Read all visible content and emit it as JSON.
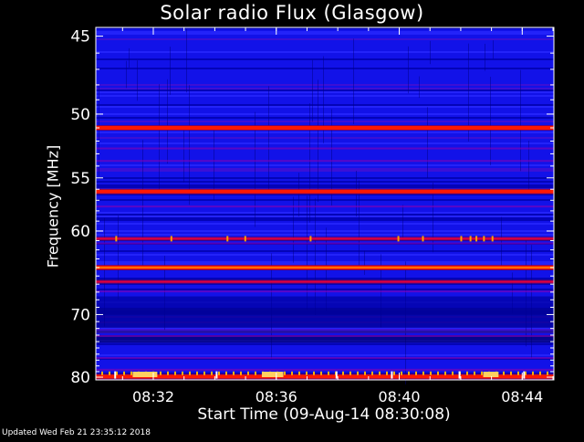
{
  "chart_data": {
    "type": "heatmap",
    "title": "Solar radio Flux (Glasgow)",
    "xlabel": "Start Time (09-Aug-14 08:30:08)",
    "ylabel": "Frequency [MHz]",
    "x_ticks": [
      "08:32",
      "08:36",
      "08:40",
      "08:44"
    ],
    "y_ticks": [
      45,
      50,
      55,
      60,
      70,
      80
    ],
    "y_tick_frequencies": [
      45,
      50,
      55,
      60,
      70,
      80
    ],
    "x_tick_minutes_after_start": [
      1.87,
      5.87,
      9.87,
      13.87
    ],
    "xlim_minutes": [
      0,
      14.9
    ],
    "ylim_mhz": [
      44.5,
      80.5
    ],
    "ylim_note": "frequency axis is reciprocal-scaled (1/f)",
    "bright_bands_mhz": [
      {
        "freq": 51.0,
        "intensity": "high"
      },
      {
        "freq": 56.2,
        "intensity": "high"
      },
      {
        "freq": 64.0,
        "intensity": "high"
      },
      {
        "freq": 65.7,
        "intensity": "medium"
      },
      {
        "freq": 60.8,
        "intensity": "medium"
      },
      {
        "freq": 79.9,
        "intensity": "high"
      }
    ],
    "colormap": [
      "#000040",
      "#1a1aff",
      "#7a00c0",
      "#ff0000",
      "#ffa000",
      "#ffff80"
    ]
  },
  "footer": "Updated Wed Feb 21 23:35:12 2018"
}
